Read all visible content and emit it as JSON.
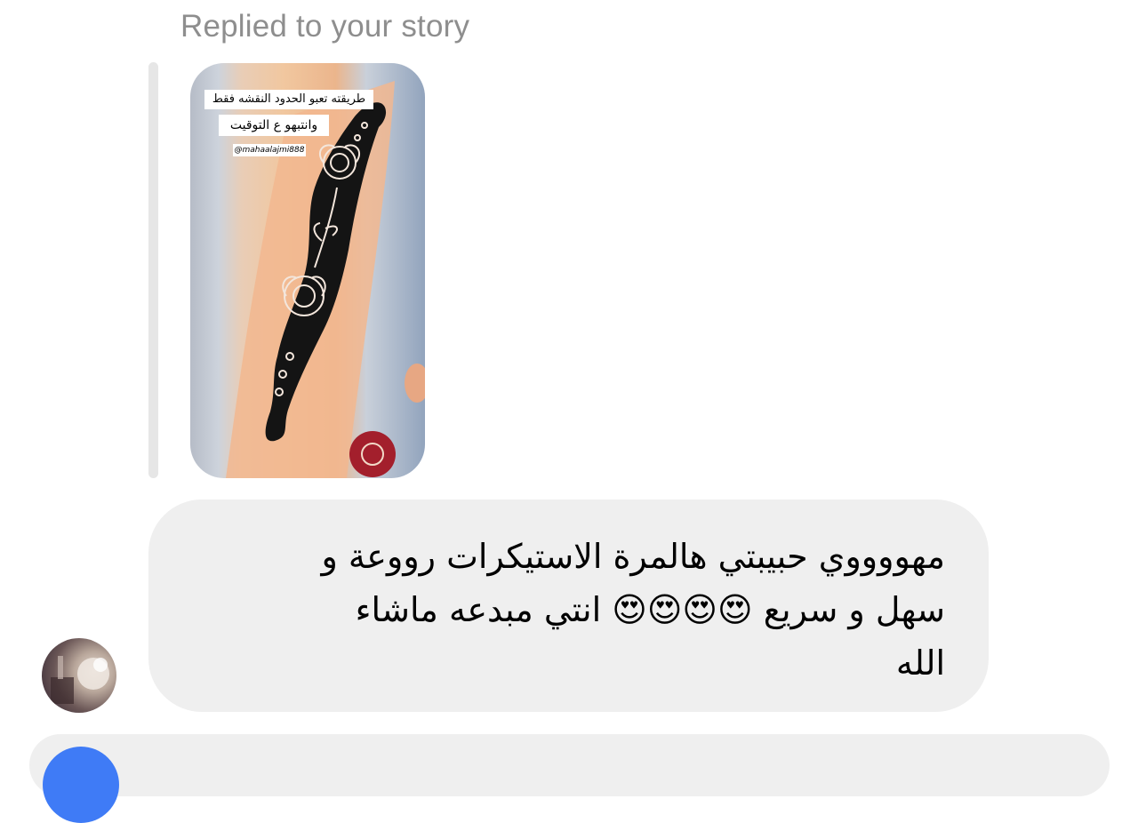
{
  "reply_header": {
    "label": "Replied to your story"
  },
  "story": {
    "caption_line_1": "طريقته تعبو الحدود النقشه فقط",
    "caption_line_2": "وانتبهو ع التوقيت",
    "handle": "@mahaalajmi888"
  },
  "message": {
    "text": "مهووووي حبيبتي هالمرة الاستيكرات رووعة و\nسهل و سريع 😍😍😍😍 انتي  مبدعه ماشاء\nالله"
  },
  "composer": {
    "camera_icon": "camera-icon"
  },
  "colors": {
    "header_text": "#8e8e8e",
    "bubble_bg": "#efefef",
    "accent": "#3f7bf6"
  }
}
